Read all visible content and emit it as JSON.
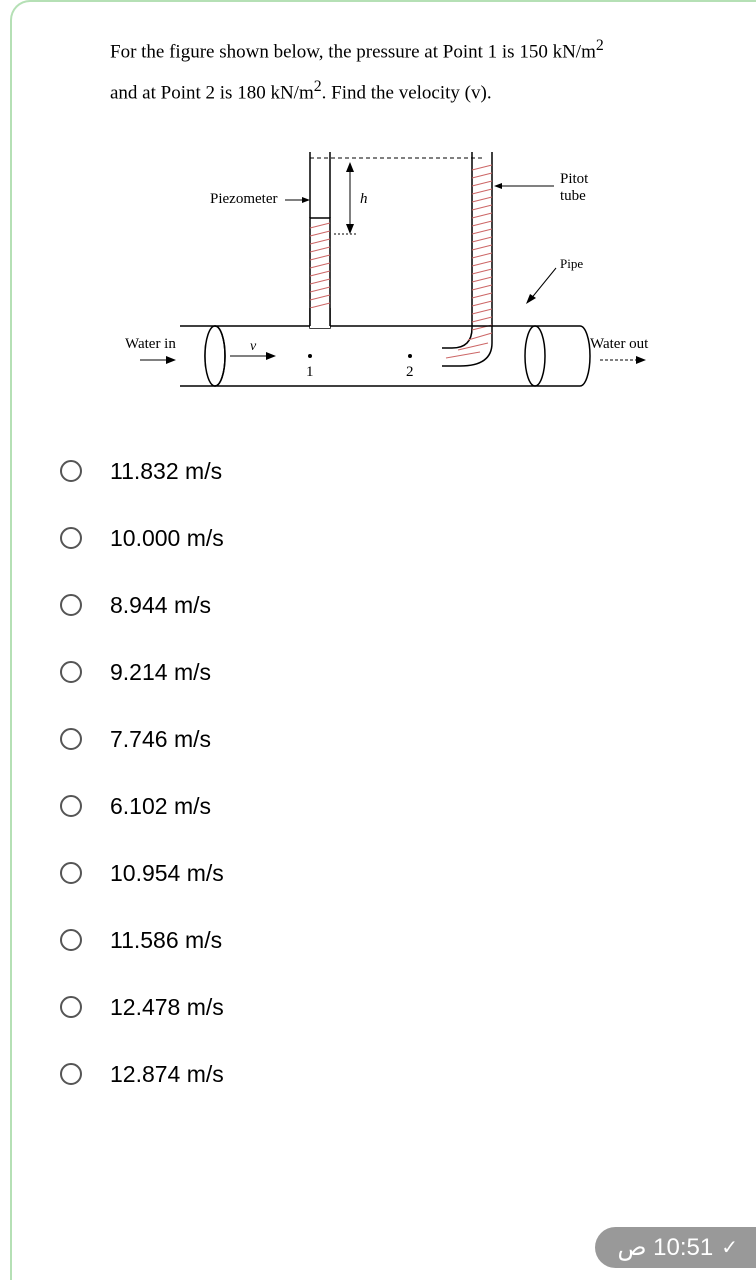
{
  "question": {
    "line1": "For the figure shown below, the pressure at Point 1 is 150 kN/m",
    "superscript1": "2",
    "line2": "and at Point 2 is 180 kN/m",
    "superscript2": "2",
    "line2b": ". Find the velocity (v)."
  },
  "figure": {
    "piezometer_label": "Piezometer",
    "pitot_label_1": "Pitot",
    "pitot_label_2": "tube",
    "pipe_label": "Pipe",
    "water_in": "Water in",
    "water_out": "Water out",
    "h_label": "h",
    "v_label": "v",
    "point1": "1",
    "point2": "2"
  },
  "options": [
    "11.832 m/s",
    "10.000 m/s",
    "8.944 m/s",
    "9.214 m/s",
    "7.746 m/s",
    "6.102 m/s",
    "10.954 m/s",
    "11.586 m/s",
    "12.478 m/s",
    "12.874 m/s"
  ],
  "time_badge": "10:51 ص"
}
